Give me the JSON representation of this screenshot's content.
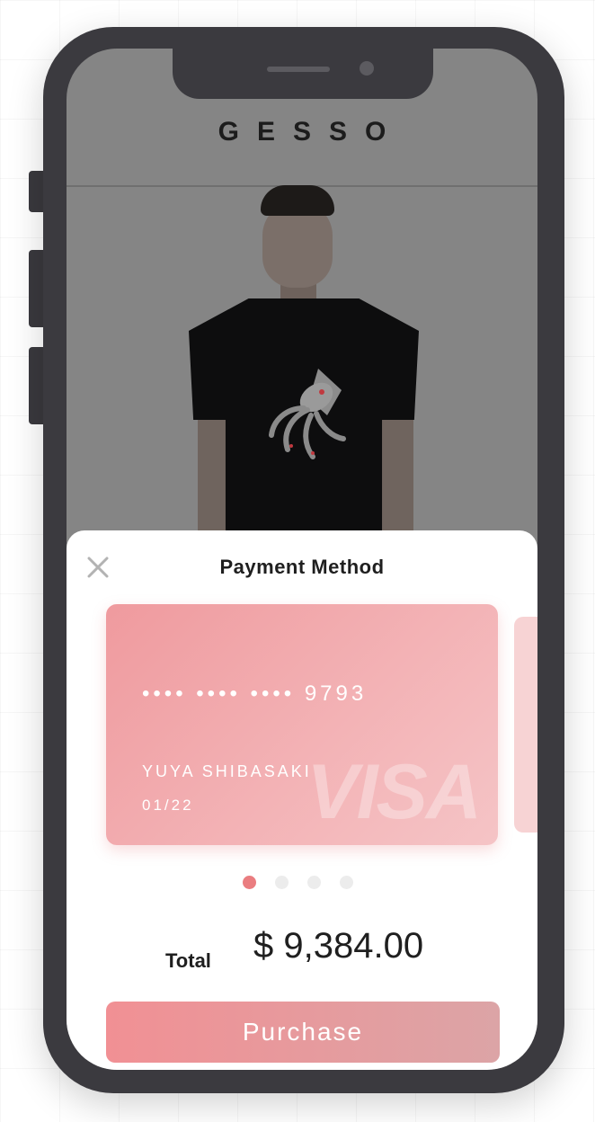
{
  "header": {
    "brand": "GESSO"
  },
  "payment_sheet": {
    "title": "Payment Method",
    "close_icon": "close-icon",
    "card": {
      "number": "•••• •••• •••• 9793",
      "holder": "YUYA SHIBASAKI",
      "expiry": "01/22",
      "network": "VISA",
      "color_start": "#ef9a9e",
      "color_end": "#f5c4c6"
    },
    "pagination": {
      "count": 4,
      "active_index": 0
    },
    "total_label": "Total",
    "total_amount": "$ 9,384.00",
    "purchase_label": "Purchase"
  },
  "colors": {
    "accent": "#ea7d80",
    "overlay": "#858585",
    "phone_frame": "#3b3a3f"
  }
}
